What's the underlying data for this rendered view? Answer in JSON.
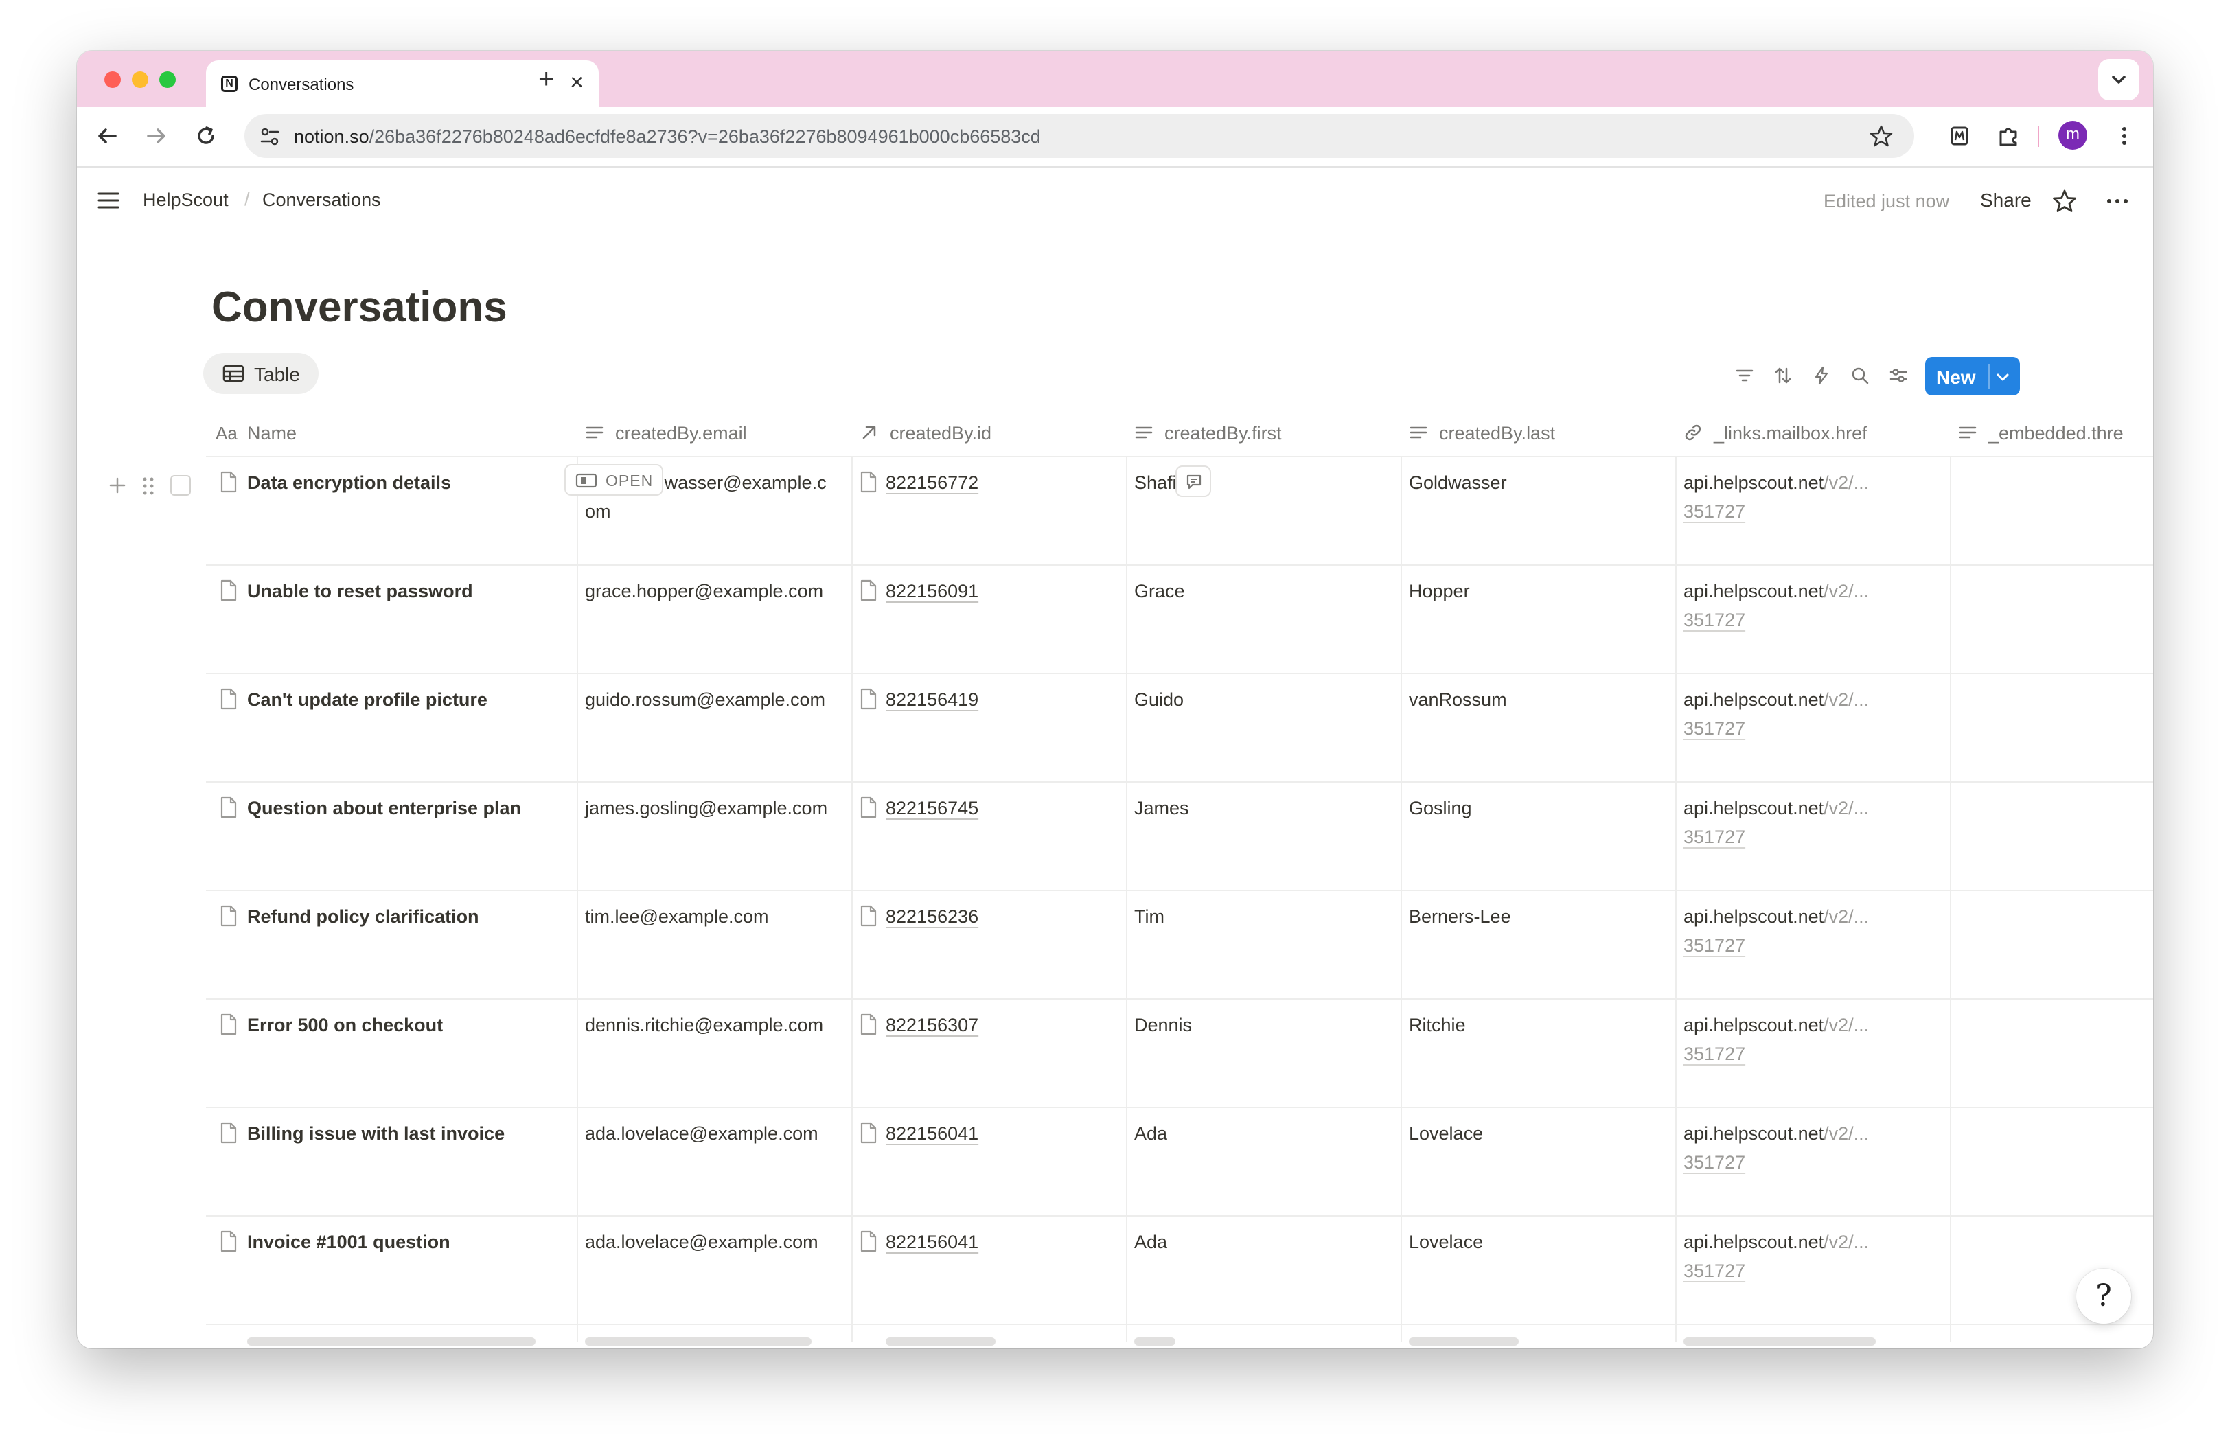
{
  "browser": {
    "tab_title": "Conversations",
    "url_host": "notion.so",
    "url_path": "/26ba36f2276b80248ad6ecfdfe8a2736?v=26ba36f2276b8094961b000cb66583cd",
    "profile_initial": "m"
  },
  "topbar": {
    "breadcrumb_parent": "HelpScout",
    "breadcrumb_current": "Conversations",
    "edited": "Edited just now",
    "share": "Share"
  },
  "page": {
    "title": "Conversations",
    "view_tab": "Table",
    "new_button": "New"
  },
  "columns": {
    "name": "Name",
    "email": "createdBy.email",
    "id": "createdBy.id",
    "first": "createdBy.first",
    "last": "createdBy.last",
    "mailbox": "_links.mailbox.href",
    "embedded": "_embedded.thre"
  },
  "rows": [
    {
      "name": "Data encryption details",
      "email": "shafi.goldwasser@example.com",
      "id": "822156772",
      "first": "Shafi",
      "last": "Goldwasser",
      "link_host": "api.helpscout.net",
      "link_rest": "/v2/...",
      "link_num": "351727"
    },
    {
      "name": "Unable to reset password",
      "email": "grace.hopper@example.com",
      "id": "822156091",
      "first": "Grace",
      "last": "Hopper",
      "link_host": "api.helpscout.net",
      "link_rest": "/v2/...",
      "link_num": "351727"
    },
    {
      "name": "Can't update profile picture",
      "email": "guido.rossum@example.com",
      "id": "822156419",
      "first": "Guido",
      "last": "vanRossum",
      "link_host": "api.helpscout.net",
      "link_rest": "/v2/...",
      "link_num": "351727"
    },
    {
      "name": "Question about enterprise plan",
      "email": "james.gosling@example.com",
      "id": "822156745",
      "first": "James",
      "last": "Gosling",
      "link_host": "api.helpscout.net",
      "link_rest": "/v2/...",
      "link_num": "351727"
    },
    {
      "name": "Refund policy clarification",
      "email": "tim.lee@example.com",
      "id": "822156236",
      "first": "Tim",
      "last": "Berners-Lee",
      "link_host": "api.helpscout.net",
      "link_rest": "/v2/...",
      "link_num": "351727"
    },
    {
      "name": "Error 500 on checkout",
      "email": "dennis.ritchie@example.com",
      "id": "822156307",
      "first": "Dennis",
      "last": "Ritchie",
      "link_host": "api.helpscout.net",
      "link_rest": "/v2/...",
      "link_num": "351727"
    },
    {
      "name": "Billing issue with last invoice",
      "email": "ada.lovelace@example.com",
      "id": "822156041",
      "first": "Ada",
      "last": "Lovelace",
      "link_host": "api.helpscout.net",
      "link_rest": "/v2/...",
      "link_num": "351727"
    },
    {
      "name": "Invoice #1001 question",
      "email": "ada.lovelace@example.com",
      "id": "822156041",
      "first": "Ada",
      "last": "Lovelace",
      "link_host": "api.helpscout.net",
      "link_rest": "/v2/...",
      "link_num": "351727"
    }
  ],
  "row_badge": "OPEN",
  "help_glyph": "?",
  "colors": {
    "tab_strip": "#f4d0e4",
    "accent": "#2383e2",
    "text": "#37352f",
    "muted": "#787774"
  }
}
